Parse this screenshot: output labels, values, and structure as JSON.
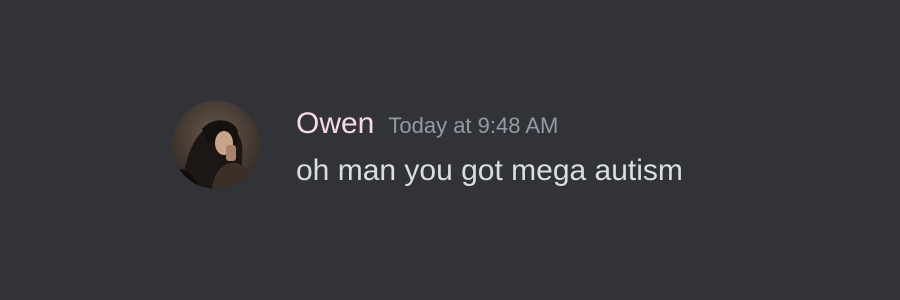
{
  "message": {
    "author": "Owen",
    "timestamp": "Today at 9:48 AM",
    "content": "oh man you got mega autism",
    "author_color": "#f9d9e8"
  },
  "theme": {
    "background": "#313338",
    "text": "#dbdee1",
    "muted": "#949ba4"
  },
  "avatar": {
    "icon": "user-avatar-photo"
  }
}
